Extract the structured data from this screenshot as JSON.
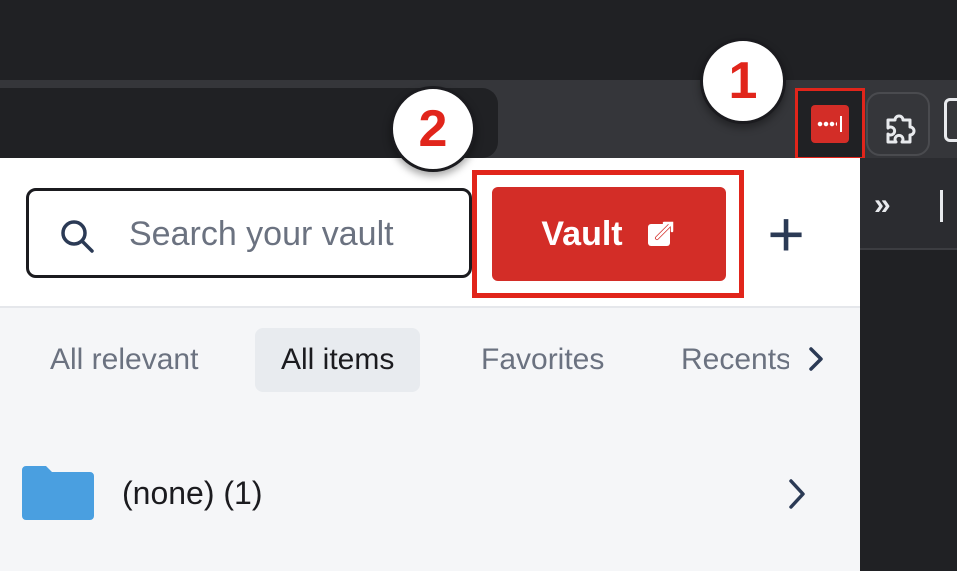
{
  "browser": {
    "extension_icon": "lastpass-icon",
    "puzzle_icon": "extensions-puzzle-icon",
    "overflow_label": "»"
  },
  "popup": {
    "search": {
      "placeholder": "Search your vault",
      "value": ""
    },
    "vault_button": {
      "label": "Vault",
      "icon": "open-external-icon"
    },
    "add_button": {
      "label": "+"
    },
    "tabs": [
      {
        "label": "All relevant",
        "active": false
      },
      {
        "label": "All items",
        "active": true
      },
      {
        "label": "Favorites",
        "active": false
      },
      {
        "label": "Recents",
        "active": false
      }
    ],
    "folders": [
      {
        "label": "(none) (1)",
        "icon": "folder-icon"
      }
    ]
  },
  "annotations": {
    "step1": "1",
    "step2": "2",
    "highlight_color": "#e1251b"
  },
  "colors": {
    "brand_red": "#d32d27",
    "folder_blue": "#4a9fe0",
    "chrome_dark": "#202124"
  }
}
